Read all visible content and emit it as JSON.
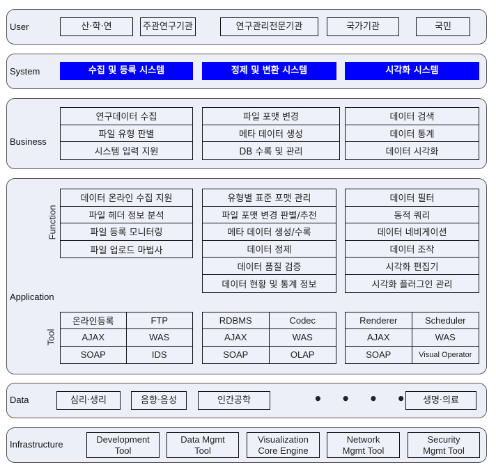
{
  "layers": {
    "user": {
      "label": "User",
      "items": [
        "산·학·연",
        "주관연구기관",
        "연구관리전문기관",
        "국가기관",
        "국민"
      ]
    },
    "system": {
      "label": "System",
      "items": [
        "수집 및 등록 시스템",
        "정제 및 변환 시스템",
        "시각화 시스템"
      ],
      "color": "#0000ff"
    },
    "business": {
      "label": "Business",
      "columns": [
        [
          "연구데이터 수집",
          "파일 유형 판별",
          "시스템 입력 지원"
        ],
        [
          "파일 포맷 변경",
          "메타 데이터 생성",
          "DB 수록 및 관리"
        ],
        [
          "데이터 검색",
          "데이터 통계",
          "데이터 시각화"
        ]
      ]
    },
    "application": {
      "label": "Application",
      "function_label": "Function",
      "tool_label": "Tool",
      "functions": [
        [
          "데이터 온라인 수집 지원",
          "파일 헤더 정보 분석",
          "파일 등록 모니터링",
          "파일 업로드 마법사"
        ],
        [
          "유형별 표준 포맷 관리",
          "파일 포맷 변경 판별/추천",
          "메타 데이터 생성/수록",
          "데이터 정제",
          "데이터 품질 검증",
          "데이터 현황 및 통계 정보"
        ],
        [
          "데이터 필터",
          "동적 쿼리",
          "데이터 네비게이션",
          "데이터 조작",
          "시각화 편집기",
          "시각화 플러그인 관리"
        ]
      ],
      "tools": [
        [
          "온라인등록",
          "FTP",
          "AJAX",
          "WAS",
          "SOAP",
          "IDS"
        ],
        [
          "RDBMS",
          "Codec",
          "AJAX",
          "WAS",
          "SOAP",
          "OLAP"
        ],
        [
          "Renderer",
          "Scheduler",
          "AJAX",
          "WAS",
          "SOAP",
          "Visual Operator"
        ]
      ]
    },
    "data": {
      "label": "Data",
      "items": [
        "심리·생리",
        "음향·음성",
        "인간공학",
        "생명·의료"
      ],
      "ellipsis": "• • • •"
    },
    "infrastructure": {
      "label": "Infrastructure",
      "items": [
        "Development Tool",
        "Data Mgmt Tool",
        "Visualization Core Engine",
        "Network Mgmt Tool",
        "Security Mgmt Tool"
      ]
    }
  }
}
